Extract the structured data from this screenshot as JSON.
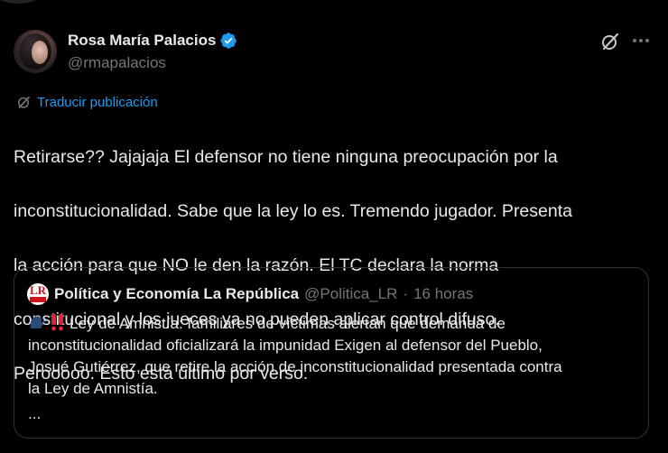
{
  "author": {
    "name": "Rosa María Palacios",
    "handle": "@rmapalacios"
  },
  "translate_label": "Traducir publicación",
  "tweet_lines": [
    "Retirarse?? Jajajaja El defensor no tiene ninguna preocupación por la",
    "inconstitucionalidad. Sabe que la ley lo es. Tremendo jugador. Presenta",
    "la acción para que NO le den la razón. El TC declara la norma",
    "constitucional y los jueces ya no pueden aplicar control difuso.",
    "Perooooo. Esto está último por verso."
  ],
  "quote": {
    "avatar_text": "LR",
    "name": "Política y Economía La República",
    "handle": "@Politica_LR",
    "separator": "·",
    "time": "16 horas",
    "lines": [
      "Ley de Amnistía: familiares de víctimas alertan que demanda de",
      "inconstitucionalidad oficializará la impunidad Exigen al defensor del Pueblo,",
      "Josué Gutiérrez, que retire la acción de inconstitucionalidad presentada contra",
      "la Ley de Amnistía."
    ],
    "ellipsis": "...",
    "emojis": [
      "speaking-head-icon",
      "double-exclamation-icon"
    ]
  },
  "colors": {
    "background": "#000000",
    "text": "#e7e9ea",
    "muted": "#71767b",
    "accent": "#1d9bf0",
    "border": "#2f3336"
  }
}
